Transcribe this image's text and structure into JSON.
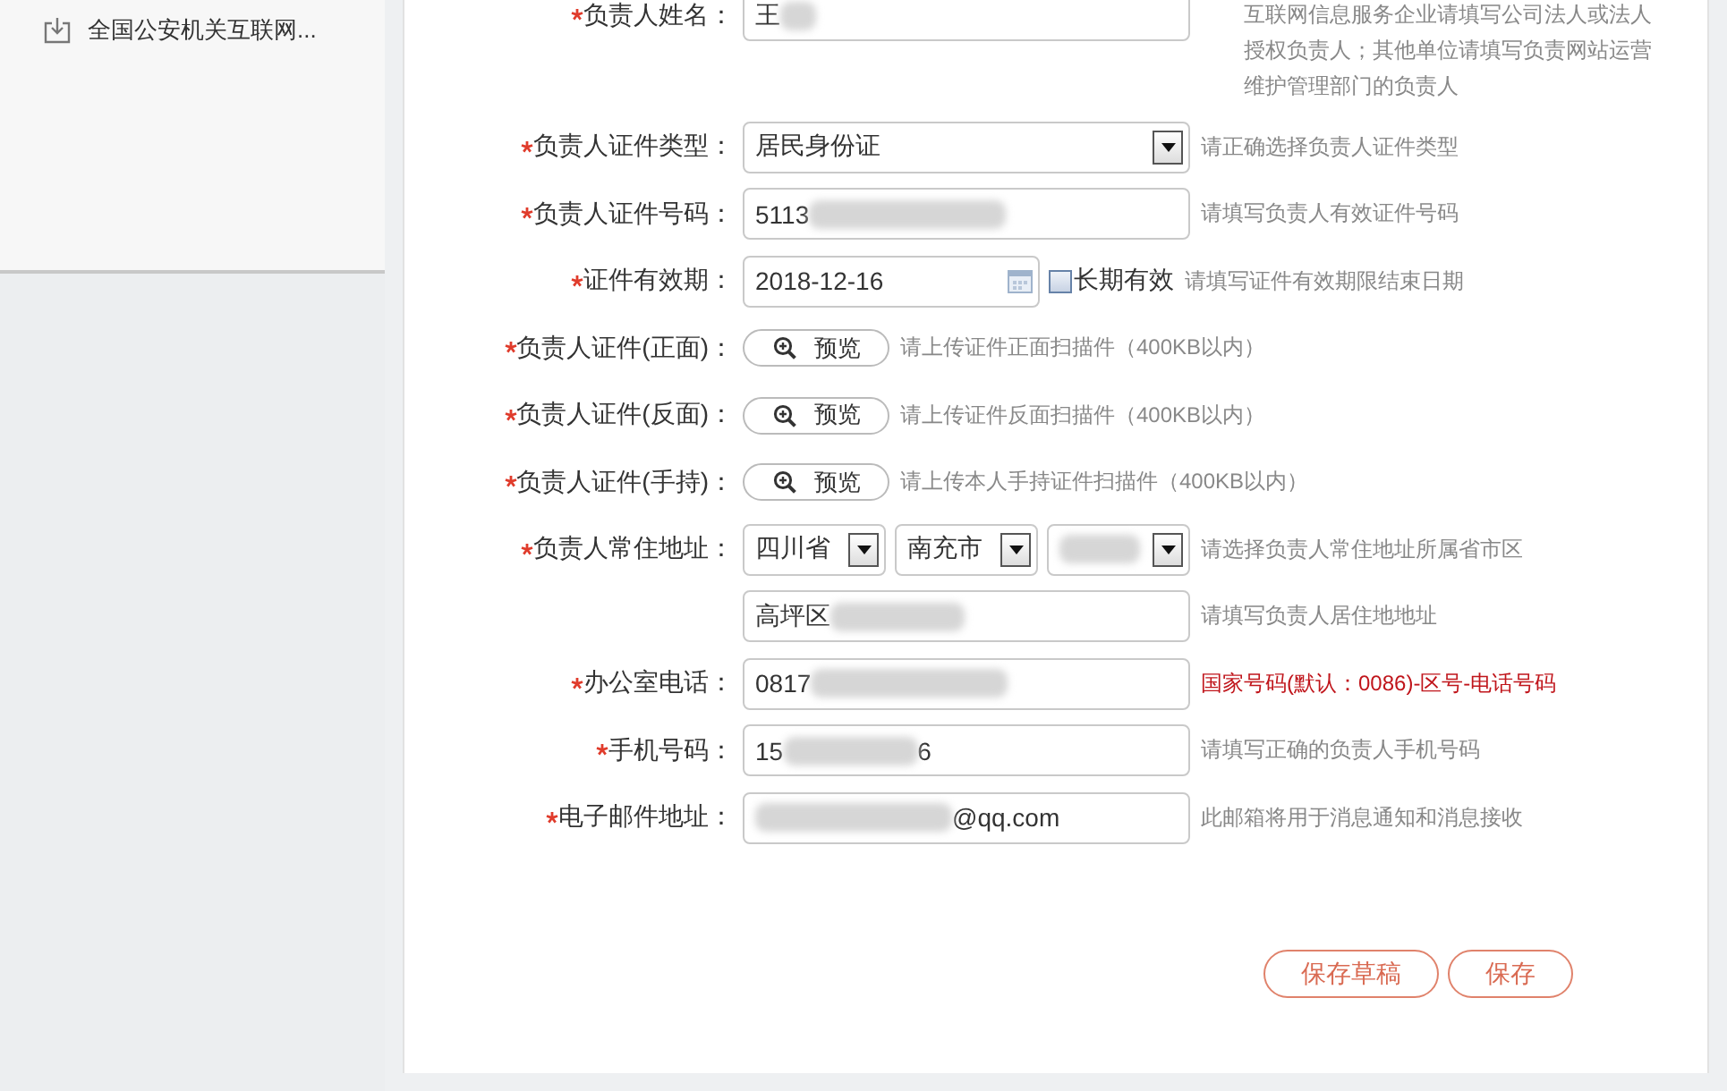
{
  "sidebar": {
    "items": [
      {
        "label": "全国公安机关互联网..."
      }
    ]
  },
  "form": {
    "rows": [
      {
        "kind": "text",
        "required": true,
        "label": "负责人姓名：",
        "segments": [
          {
            "kind": "text",
            "text": "王"
          },
          {
            "kind": "blur"
          }
        ],
        "hint": "互联网信息服务企业请填写公司法人或法人授权负责人；其他单位请填写负责网站运营维护管理部门的负责人",
        "hint_alert": false
      },
      {
        "kind": "select",
        "required": true,
        "label": "负责人证件类型：",
        "selects": [
          {
            "segments": [
              {
                "kind": "text",
                "text": "居民身份证"
              }
            ]
          }
        ],
        "hint": "请正确选择负责人证件类型",
        "hint_alert": false
      },
      {
        "kind": "text",
        "required": true,
        "label": "负责人证件号码：",
        "segments": [
          {
            "kind": "text",
            "text": "5113"
          },
          {
            "kind": "blur"
          }
        ],
        "hint": "请填写负责人有效证件号码",
        "hint_alert": false
      },
      {
        "kind": "date",
        "required": true,
        "label": "证件有效期：",
        "segments": [
          {
            "kind": "text",
            "text": "2018-12-16"
          }
        ],
        "checkbox": {
          "label": "长期有效",
          "checked": false
        },
        "hint": "请填写证件有效期限结束日期",
        "hint_alert": false
      },
      {
        "kind": "upload",
        "required": true,
        "label": "负责人证件(正面)：",
        "button": "预览",
        "hint": "请上传证件正面扫描件（400KB以内）",
        "hint_alert": false
      },
      {
        "kind": "upload",
        "required": true,
        "label": "负责人证件(反面)：",
        "button": "预览",
        "hint": "请上传证件反面扫描件（400KB以内）",
        "hint_alert": false
      },
      {
        "kind": "upload",
        "required": true,
        "label": "负责人证件(手持)：",
        "button": "预览",
        "hint": "请上传本人手持证件扫描件（400KB以内）",
        "hint_alert": false
      },
      {
        "kind": "select",
        "required": true,
        "label": "负责人常住地址：",
        "selects": [
          {
            "segments": [
              {
                "kind": "text",
                "text": "四川省"
              }
            ]
          },
          {
            "segments": [
              {
                "kind": "text",
                "text": "南充市"
              }
            ]
          },
          {
            "segments": [
              {
                "kind": "blur"
              }
            ]
          }
        ],
        "hint": "请选择负责人常住地址所属省市区",
        "hint_alert": false
      },
      {
        "kind": "text",
        "required": false,
        "segments": [
          {
            "kind": "text",
            "text": "高坪区"
          },
          {
            "kind": "blur"
          }
        ],
        "hint": "请填写负责人居住地地址",
        "hint_alert": false
      },
      {
        "kind": "text",
        "required": true,
        "label": "办公室电话：",
        "segments": [
          {
            "kind": "text",
            "text": "0817"
          },
          {
            "kind": "blur"
          }
        ],
        "hint": "国家号码(默认：0086)-区号-电话号码",
        "hint_alert": true
      },
      {
        "kind": "text",
        "required": true,
        "label": "手机号码：",
        "segments": [
          {
            "kind": "text",
            "text": "15"
          },
          {
            "kind": "blur"
          },
          {
            "kind": "text",
            "text": "6"
          }
        ],
        "hint": "请填写正确的负责人手机号码",
        "hint_alert": false
      },
      {
        "kind": "text",
        "required": true,
        "label": "电子邮件地址：",
        "segments": [
          {
            "kind": "blur"
          },
          {
            "kind": "text",
            "text": "@qq.com"
          }
        ],
        "hint": "此邮箱将用于消息通知和消息接收",
        "hint_alert": false
      }
    ],
    "buttons": [
      {
        "label": "保存草稿"
      },
      {
        "label": "保存"
      }
    ]
  }
}
